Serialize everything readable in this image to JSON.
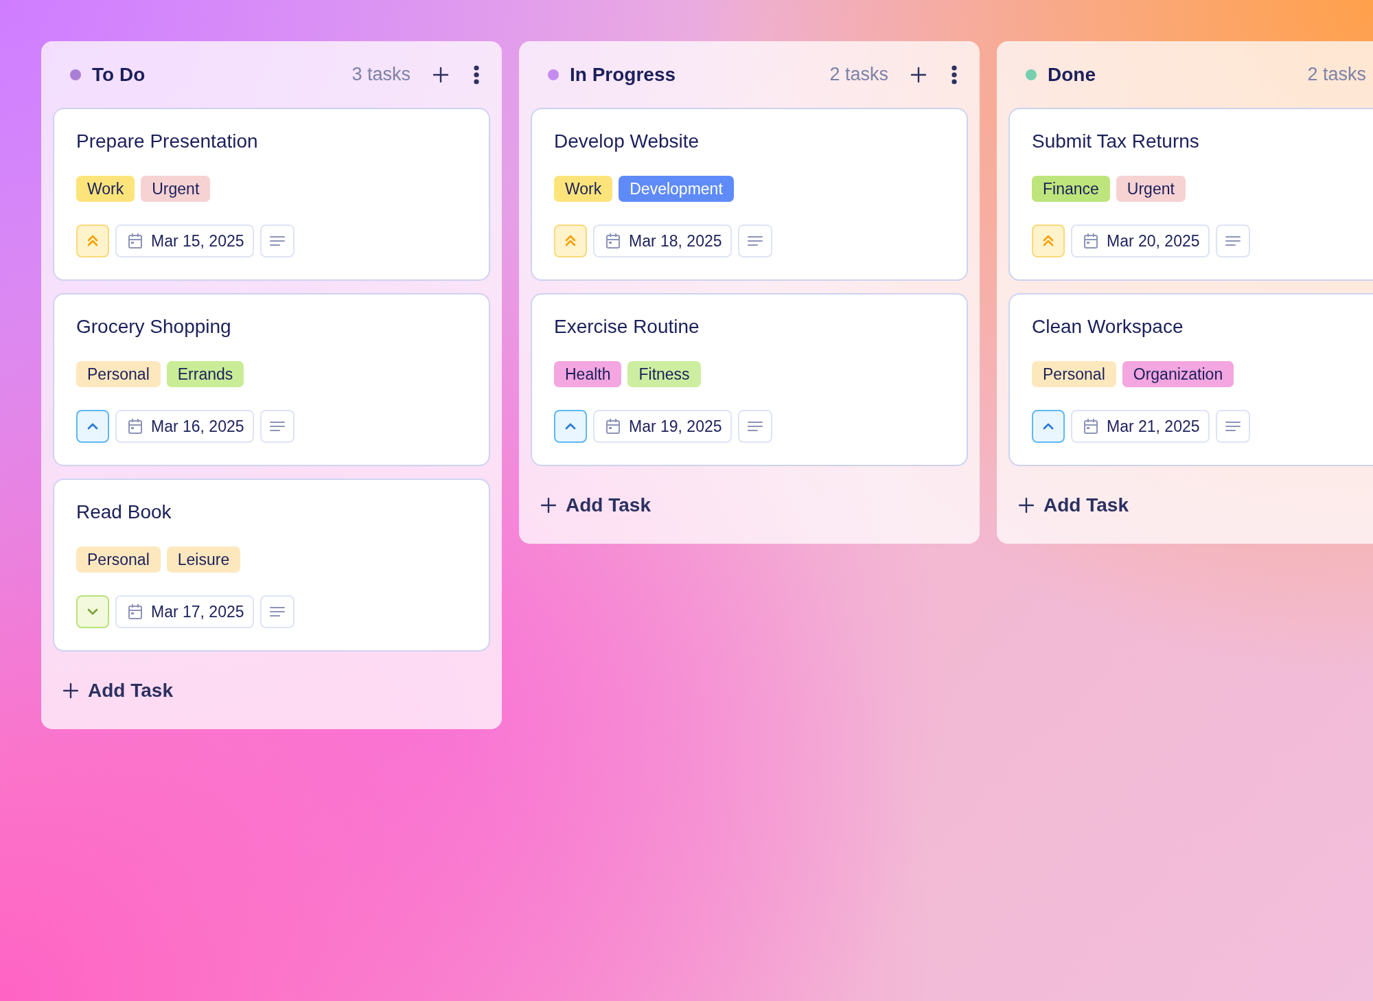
{
  "columns": [
    {
      "title": "To Do",
      "color": "#a97fd6",
      "count": "3 tasks",
      "add_label": "Add Task",
      "tasks": [
        {
          "title": "Prepare Presentation",
          "tags": [
            {
              "label": "Work",
              "color": "#fde47a"
            },
            {
              "label": "Urgent",
              "color": "#f6d2d3"
            }
          ],
          "priority": {
            "kind": "high"
          },
          "due": "Mar 15, 2025"
        },
        {
          "title": "Grocery Shopping",
          "tags": [
            {
              "label": "Personal",
              "color": "#fde8be"
            },
            {
              "label": "Errands",
              "color": "#c9ec97"
            }
          ],
          "priority": {
            "kind": "medium"
          },
          "due": "Mar 16, 2025"
        },
        {
          "title": "Read Book",
          "tags": [
            {
              "label": "Personal",
              "color": "#fde8be"
            },
            {
              "label": "Leisure",
              "color": "#fde8be"
            }
          ],
          "priority": {
            "kind": "low"
          },
          "due": "Mar 17, 2025"
        }
      ]
    },
    {
      "title": "In Progress",
      "color": "#c58cf0",
      "count": "2 tasks",
      "add_label": "Add Task",
      "tasks": [
        {
          "title": "Develop Website",
          "tags": [
            {
              "label": "Work",
              "color": "#fde47a"
            },
            {
              "label": "Development",
              "color": "#5f8bf9"
            }
          ],
          "priority": {
            "kind": "high"
          },
          "due": "Mar 18, 2025"
        },
        {
          "title": "Exercise Routine",
          "tags": [
            {
              "label": "Health",
              "color": "#f3a6e0"
            },
            {
              "label": "Fitness",
              "color": "#cdeea0"
            }
          ],
          "priority": {
            "kind": "medium"
          },
          "due": "Mar 19, 2025"
        }
      ]
    },
    {
      "title": "Done",
      "color": "#76d0ae",
      "count": "2 tasks",
      "add_label": "Add Task",
      "tasks": [
        {
          "title": "Submit Tax Returns",
          "tags": [
            {
              "label": "Finance",
              "color": "#bde57b"
            },
            {
              "label": "Urgent",
              "color": "#f6d2d3"
            }
          ],
          "priority": {
            "kind": "high"
          },
          "due": "Mar 20, 2025"
        },
        {
          "title": "Clean Workspace",
          "tags": [
            {
              "label": "Personal",
              "color": "#fde8be"
            },
            {
              "label": "Organization",
              "color": "#f3a6e0"
            }
          ],
          "priority": {
            "kind": "medium"
          },
          "due": "Mar 21, 2025"
        }
      ]
    }
  ]
}
